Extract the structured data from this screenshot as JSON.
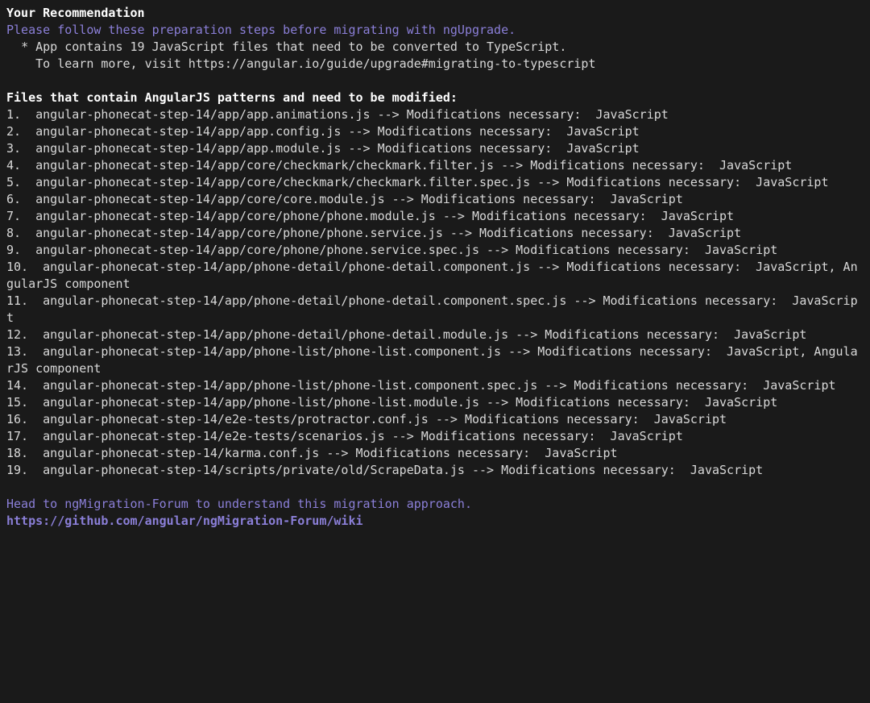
{
  "header": {
    "title": "Your Recommendation",
    "subtitle": "Please follow these preparation steps before migrating with ngUpgrade.",
    "bullet": "  * App contains 19 JavaScript files that need to be converted to TypeScript.",
    "learn_more": "    To learn more, visit https://angular.io/guide/upgrade#migrating-to-typescript"
  },
  "files_header": "Files that contain AngularJS patterns and need to be modified:",
  "files": [
    "1.  angular-phonecat-step-14/app/app.animations.js --> Modifications necessary:  JavaScript",
    "2.  angular-phonecat-step-14/app/app.config.js --> Modifications necessary:  JavaScript",
    "3.  angular-phonecat-step-14/app/app.module.js --> Modifications necessary:  JavaScript",
    "4.  angular-phonecat-step-14/app/core/checkmark/checkmark.filter.js --> Modifications necessary:  JavaScript",
    "5.  angular-phonecat-step-14/app/core/checkmark/checkmark.filter.spec.js --> Modifications necessary:  JavaScript",
    "6.  angular-phonecat-step-14/app/core/core.module.js --> Modifications necessary:  JavaScript",
    "7.  angular-phonecat-step-14/app/core/phone/phone.module.js --> Modifications necessary:  JavaScript",
    "8.  angular-phonecat-step-14/app/core/phone/phone.service.js --> Modifications necessary:  JavaScript",
    "9.  angular-phonecat-step-14/app/core/phone/phone.service.spec.js --> Modifications necessary:  JavaScript",
    "10.  angular-phonecat-step-14/app/phone-detail/phone-detail.component.js --> Modifications necessary:  JavaScript, AngularJS component",
    "11.  angular-phonecat-step-14/app/phone-detail/phone-detail.component.spec.js --> Modifications necessary:  JavaScript",
    "12.  angular-phonecat-step-14/app/phone-detail/phone-detail.module.js --> Modifications necessary:  JavaScript",
    "13.  angular-phonecat-step-14/app/phone-list/phone-list.component.js --> Modifications necessary:  JavaScript, AngularJS component",
    "14.  angular-phonecat-step-14/app/phone-list/phone-list.component.spec.js --> Modifications necessary:  JavaScript",
    "15.  angular-phonecat-step-14/app/phone-list/phone-list.module.js --> Modifications necessary:  JavaScript",
    "16.  angular-phonecat-step-14/e2e-tests/protractor.conf.js --> Modifications necessary:  JavaScript",
    "17.  angular-phonecat-step-14/e2e-tests/scenarios.js --> Modifications necessary:  JavaScript",
    "18.  angular-phonecat-step-14/karma.conf.js --> Modifications necessary:  JavaScript",
    "19.  angular-phonecat-step-14/scripts/private/old/ScrapeData.js --> Modifications necessary:  JavaScript"
  ],
  "footer": {
    "forum_text": "Head to ngMigration-Forum to understand this migration approach.",
    "forum_link": "https://github.com/angular/ngMigration-Forum/wiki"
  }
}
